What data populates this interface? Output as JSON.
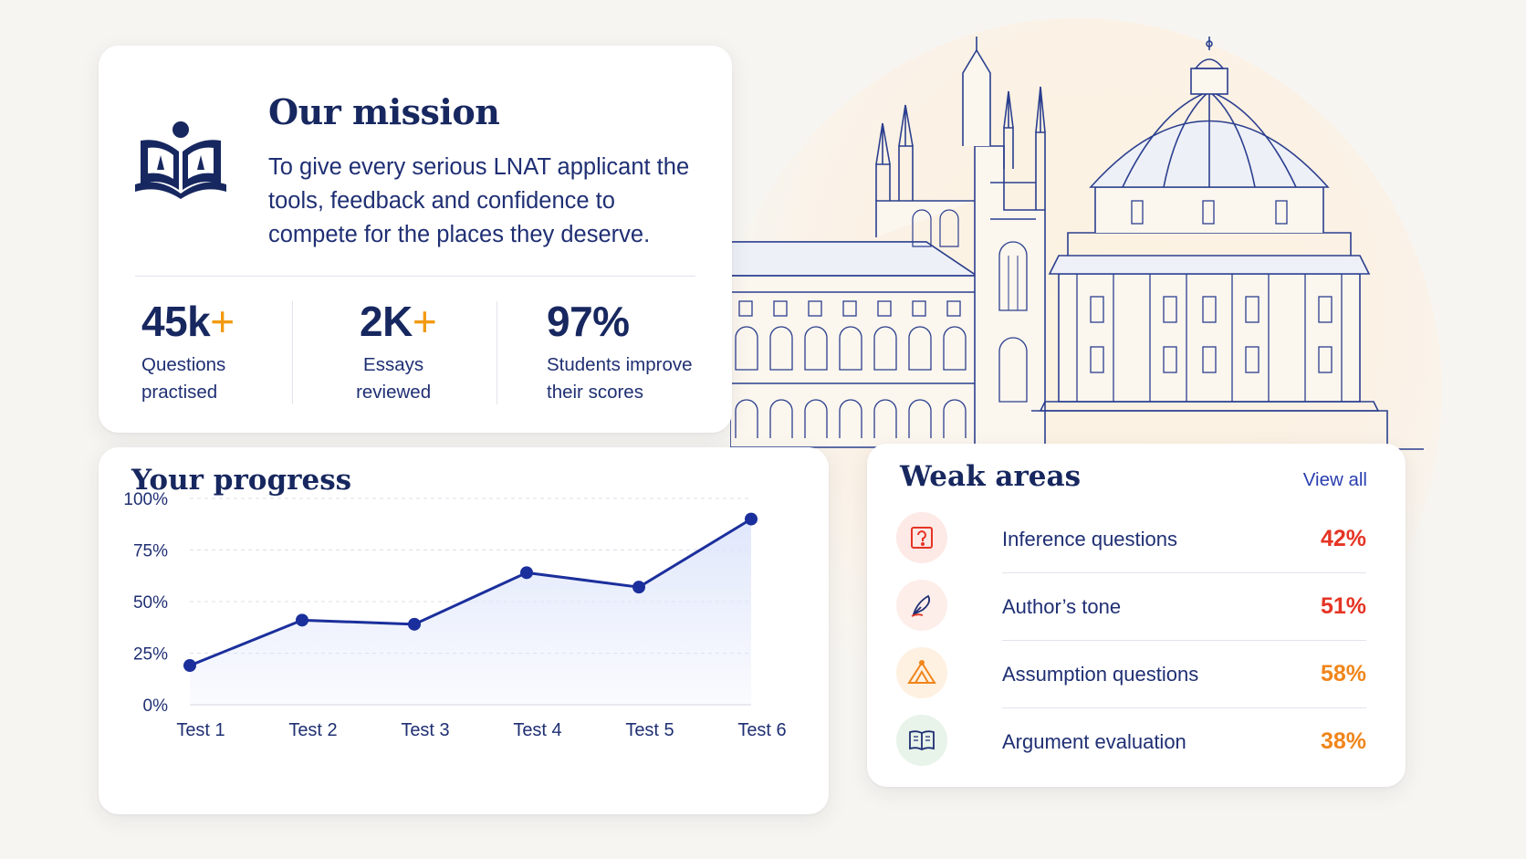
{
  "mission": {
    "title": "Our mission",
    "body": "To give every serious LNAT applicant the tools, feedback and confidence to compete for the places they deserve.",
    "stats": [
      {
        "value": "45k",
        "plus": "+",
        "label_line1": "Questions",
        "label_line2": "practised"
      },
      {
        "value": "2K",
        "plus": "+",
        "label_line1": "Essays",
        "label_line2": "reviewed"
      },
      {
        "value": "97%",
        "plus": "",
        "label_line1": "Students improve",
        "label_line2": "their scores"
      }
    ]
  },
  "progress": {
    "title": "Your progress"
  },
  "chart_data": {
    "type": "area",
    "title": "Your progress",
    "categories": [
      "Test 1",
      "Test 2",
      "Test 3",
      "Test 4",
      "Test 5",
      "Test 6"
    ],
    "values": [
      19,
      41,
      39,
      64,
      57,
      90
    ],
    "y_ticks": [
      "0%",
      "25%",
      "50%",
      "75%",
      "100%"
    ],
    "ylim": [
      0,
      100
    ],
    "grid": "horizontal dashed",
    "line_color": "#1b2f9c",
    "fill_color": "#dfe6fb"
  },
  "weak_areas": {
    "title": "Weak areas",
    "view_all": "View all",
    "items": [
      {
        "label": "Inference questions",
        "percent": "42%",
        "icon": "question-box-icon",
        "color": "#e53424",
        "bg": "#fde9e6"
      },
      {
        "label": "Author’s tone",
        "percent": "51%",
        "icon": "quill-icon",
        "color": "#e53424",
        "bg": "#fdeeea"
      },
      {
        "label": "Assumption questions",
        "percent": "58%",
        "icon": "triangle-puzzle-icon",
        "color": "#f0851a",
        "bg": "#fff1e1"
      },
      {
        "label": "Argument evaluation",
        "percent": "38%",
        "icon": "open-book-icon",
        "color": "#f0851a",
        "bg": "#e8f3ea"
      }
    ]
  }
}
